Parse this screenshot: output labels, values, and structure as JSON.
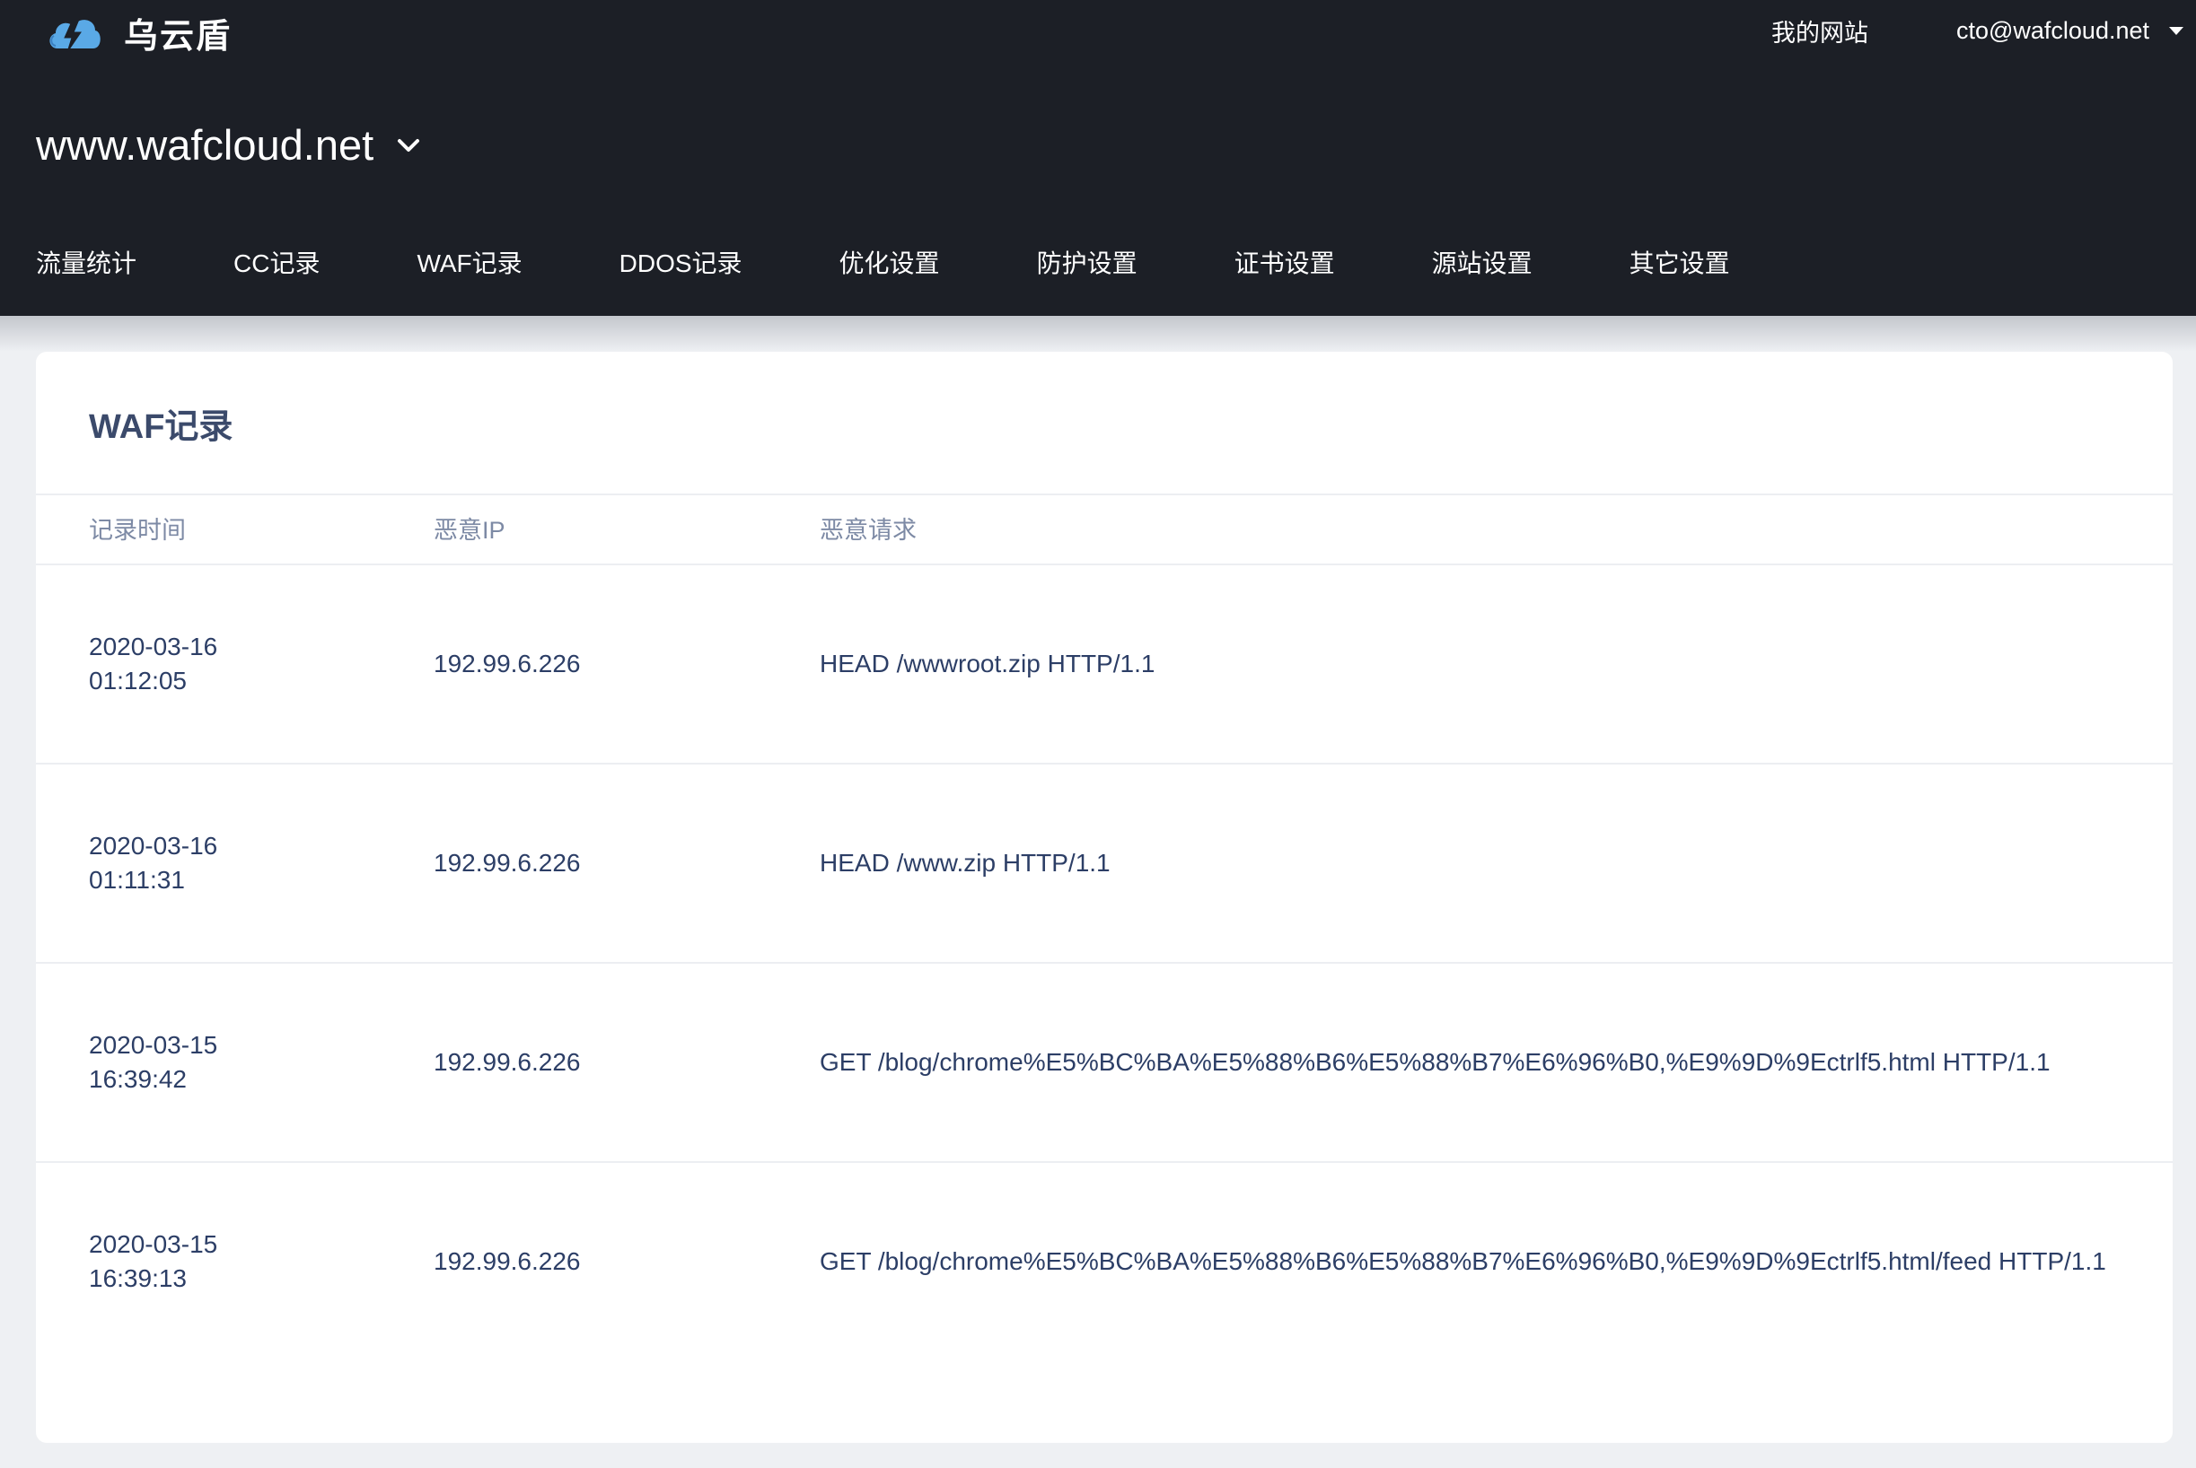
{
  "app": {
    "name": "乌云盾"
  },
  "top_nav": {
    "my_sites": "我的网站",
    "user_email": "cto@wafcloud.net"
  },
  "site": {
    "current": "www.wafcloud.net"
  },
  "nav": {
    "items": [
      {
        "label": "流量统计"
      },
      {
        "label": "CC记录"
      },
      {
        "label": "WAF记录"
      },
      {
        "label": "DDOS记录"
      },
      {
        "label": "优化设置"
      },
      {
        "label": "防护设置"
      },
      {
        "label": "证书设置"
      },
      {
        "label": "源站设置"
      },
      {
        "label": "其它设置"
      }
    ]
  },
  "card": {
    "title": "WAF记录",
    "columns": {
      "time": "记录时间",
      "ip": "恶意IP",
      "request": "恶意请求"
    },
    "rows": [
      {
        "date": "2020-03-16",
        "time": "01:12:05",
        "ip": "192.99.6.226",
        "request": "HEAD /wwwroot.zip HTTP/1.1"
      },
      {
        "date": "2020-03-16",
        "time": "01:11:31",
        "ip": "192.99.6.226",
        "request": "HEAD /www.zip HTTP/1.1"
      },
      {
        "date": "2020-03-15",
        "time": "16:39:42",
        "ip": "192.99.6.226",
        "request": "GET /blog/chrome%E5%BC%BA%E5%88%B6%E5%88%B7%E6%96%B0,%E9%9D%9Ectrlf5.html HTTP/1.1"
      },
      {
        "date": "2020-03-15",
        "time": "16:39:13",
        "ip": "192.99.6.226",
        "request": "GET /blog/chrome%E5%BC%BA%E5%88%B6%E5%88%B7%E6%96%B0,%E9%9D%9Ectrlf5.html/feed HTTP/1.1"
      }
    ]
  },
  "colors": {
    "header_bg": "#1c1f26",
    "page_bg": "#eef0f3",
    "title_text": "#3b4a6b",
    "column_header_text": "#7d8aa5",
    "cell_text": "#2c3e66",
    "logo_blue": "#5aa9e6"
  },
  "icons": {
    "logo": "cloud-lightning-icon",
    "user_menu": "caret-down-icon",
    "site_selector": "chevron-down-icon"
  }
}
